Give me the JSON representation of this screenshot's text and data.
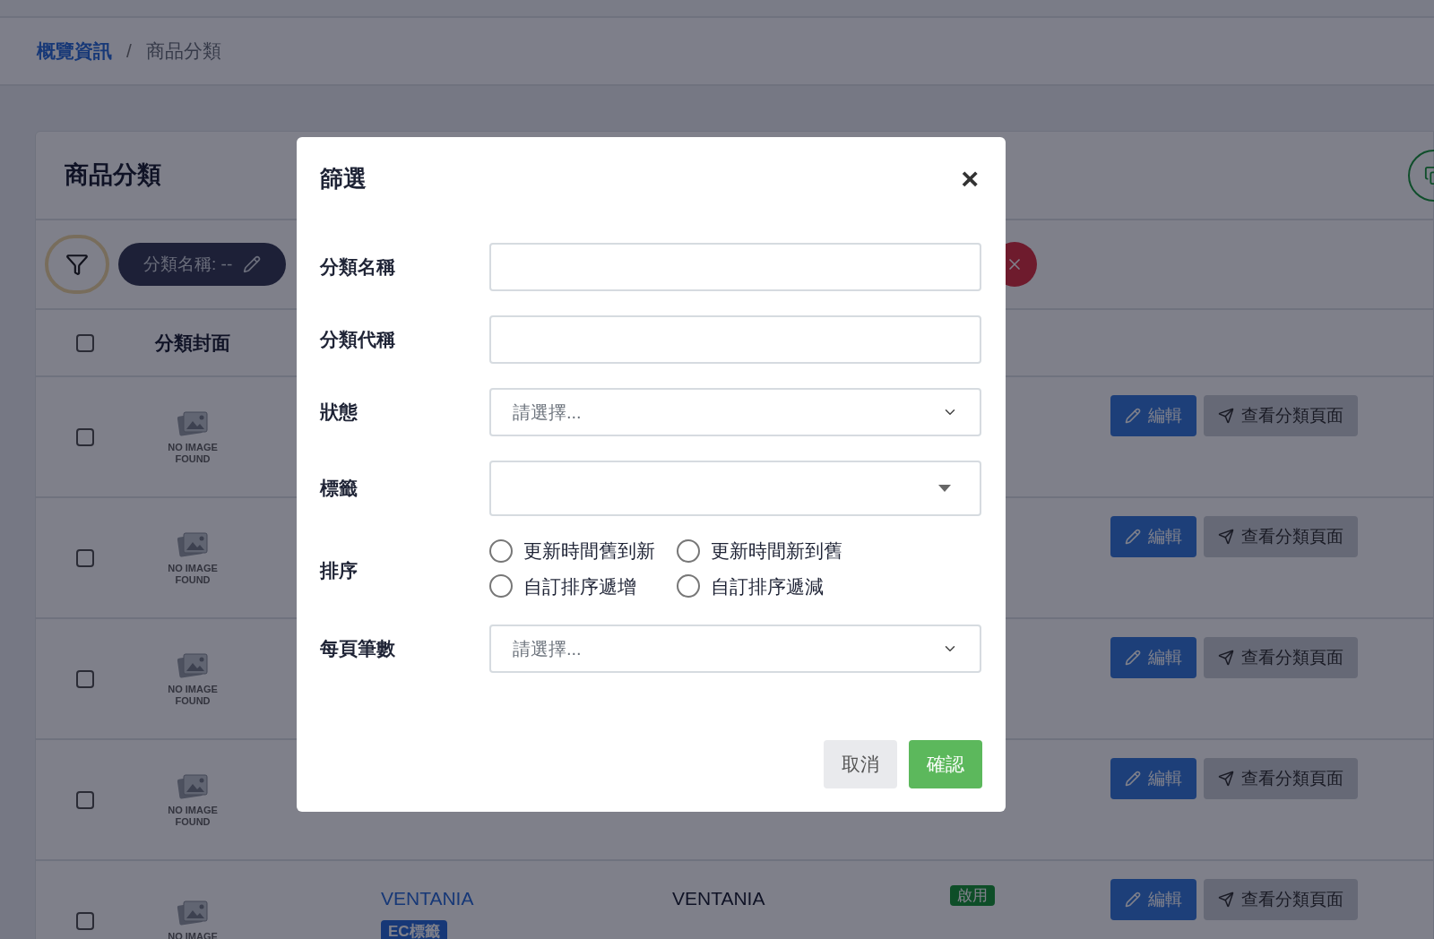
{
  "breadcrumb": [
    {
      "label": "概覽資訊",
      "kind": "link"
    },
    {
      "label": "商品分類",
      "kind": "current"
    }
  ],
  "breadcrumb_separator": "/",
  "card": {
    "title": "商品分類"
  },
  "filter_chips": [
    {
      "label": "分類名稱: --"
    }
  ],
  "table": {
    "select_all_checked": false,
    "columns": [
      {
        "label": "分類封面"
      }
    ],
    "rows": [
      {
        "checked": false,
        "image_text": [
          "NO IMAGE",
          "FOUND"
        ],
        "actions": [
          "編輯",
          "查看分類頁面"
        ]
      },
      {
        "checked": false,
        "image_text": [
          "NO IMAGE",
          "FOUND"
        ],
        "actions": [
          "編輯",
          "查看分類頁面"
        ]
      },
      {
        "checked": false,
        "image_text": [
          "NO IMAGE",
          "FOUND"
        ],
        "actions": [
          "編輯",
          "查看分類頁面"
        ]
      },
      {
        "checked": false,
        "image_text": [
          "NO IMAGE",
          "FOUND"
        ],
        "actions": [
          "編輯",
          "查看分類頁面"
        ]
      },
      {
        "checked": false,
        "image_text": [
          "NO IMAGE"
        ],
        "name": "VENTANIA",
        "tag": "EC標籤",
        "code": "VENTANIA",
        "status": "啟用",
        "actions": [
          "編輯",
          "查看分類頁面"
        ]
      }
    ]
  },
  "modal": {
    "title": "篩選",
    "close": "×",
    "fields": [
      {
        "label": "分類名稱",
        "kind": "text"
      },
      {
        "label": "分類代稱",
        "kind": "text"
      },
      {
        "label": "狀態",
        "kind": "select",
        "placeholder": "請選擇..."
      },
      {
        "label": "標籤",
        "kind": "multiselect"
      },
      {
        "label": "排序",
        "kind": "radio",
        "options": [
          {
            "label": "更新時間舊到新",
            "selected": false
          },
          {
            "label": "更新時間新到舊",
            "selected": false
          },
          {
            "label": "自訂排序遞增",
            "selected": false
          },
          {
            "label": "自訂排序遞減",
            "selected": false
          }
        ]
      },
      {
        "label": "每頁筆數",
        "kind": "select",
        "placeholder": "請選擇..."
      }
    ],
    "buttons": [
      {
        "label": "取消",
        "kind": "secondary"
      },
      {
        "label": "確認",
        "kind": "primary"
      }
    ]
  }
}
